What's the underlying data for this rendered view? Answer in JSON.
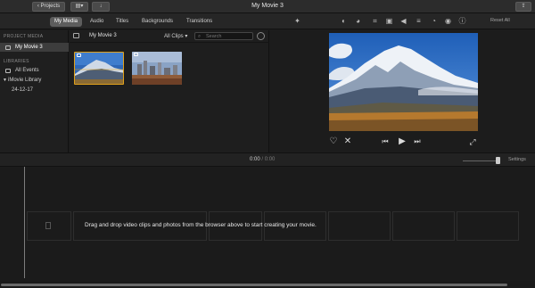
{
  "window": {
    "title": "My Movie 3"
  },
  "toolbar": {
    "back_label": "Projects"
  },
  "tabs": [
    {
      "label": "My Media",
      "active": true
    },
    {
      "label": "Audio",
      "active": false
    },
    {
      "label": "Titles",
      "active": false
    },
    {
      "label": "Backgrounds",
      "active": false
    },
    {
      "label": "Transitions",
      "active": false
    }
  ],
  "adjust_tools": [
    "magic-wand-icon",
    "color-balance-icon",
    "color-correction-icon",
    "crop-icon",
    "stabilization-icon",
    "volume-icon",
    "noise-reduction-icon",
    "speed-icon",
    "video-overlay-icon",
    "clip-info-icon"
  ],
  "reset_all_label": "Reset All",
  "library": {
    "project_header": "PROJECT MEDIA",
    "project_item": "My Movie 3",
    "libraries_header": "LIBRARIES",
    "all_events": "All Events",
    "imovie_library": "iMovie Library",
    "event_date": "24-12-17"
  },
  "browser": {
    "title": "My Movie 3",
    "filter": "All Clips",
    "search_placeholder": "Search",
    "clips": [
      {
        "name": "mountain-clip",
        "selected": true
      },
      {
        "name": "city-clip",
        "selected": false
      }
    ]
  },
  "timeline": {
    "current_time": "0:00",
    "separator": "/",
    "total_time": "0:00",
    "settings_label": "Settings",
    "drop_message": "Drag and drop video clips and photos from the browser above to start creating your movie."
  },
  "colors": {
    "accent": "#e0a11b",
    "selected_tab": "#5d5d5d"
  }
}
